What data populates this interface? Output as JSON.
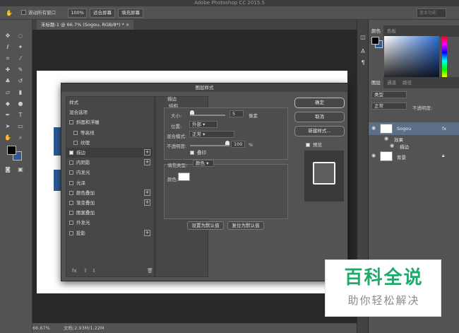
{
  "app": {
    "title": "Adobe Photoshop CC 2015.5"
  },
  "options_bar": {
    "scroll_all_label": "滚动所有窗口",
    "zoom_btn": "100%",
    "fit_screen_btn": "适合屏幕",
    "fill_screen_btn": "填充屏幕",
    "workspace": "基本功能"
  },
  "document": {
    "tab_label": "未标题-1 @ 66.7% (Sogou, RGB/8*) *",
    "zoom": "66.67%",
    "doc_info": "文档:2.93M/1.22M"
  },
  "colors": {
    "foreground": "#050505",
    "background": "#2a5d96"
  },
  "right_panel": {
    "color_tab": "颜色",
    "swatches_tab": "色板",
    "layers_tab": "图层",
    "channels_tab": "通道",
    "paths_tab": "路径",
    "kind_filter": "类型",
    "blend_mode": "正常",
    "opacity_label": "不透明度:",
    "layers": [
      {
        "name": "Sogou",
        "fx": "fx"
      },
      {
        "name": "效果"
      },
      {
        "name": "描边"
      },
      {
        "name": "背景"
      }
    ]
  },
  "dialog": {
    "title": "图层样式",
    "styles": [
      {
        "label": "样式",
        "checkbox": false,
        "plus": false,
        "checked": false,
        "indent": 0
      },
      {
        "label": "混合选项",
        "checkbox": false,
        "plus": false,
        "checked": false,
        "indent": 0
      },
      {
        "label": "斜面和浮雕",
        "checkbox": true,
        "plus": false,
        "checked": false,
        "indent": 0
      },
      {
        "label": "等高线",
        "checkbox": true,
        "plus": false,
        "checked": false,
        "indent": 1
      },
      {
        "label": "纹理",
        "checkbox": true,
        "plus": false,
        "checked": false,
        "indent": 1
      },
      {
        "label": "描边",
        "checkbox": true,
        "plus": true,
        "checked": true,
        "indent": 0
      },
      {
        "label": "内阴影",
        "checkbox": true,
        "plus": true,
        "checked": false,
        "indent": 0
      },
      {
        "label": "内发光",
        "checkbox": true,
        "plus": false,
        "checked": false,
        "indent": 0
      },
      {
        "label": "光泽",
        "checkbox": true,
        "plus": false,
        "checked": false,
        "indent": 0
      },
      {
        "label": "颜色叠加",
        "checkbox": true,
        "plus": true,
        "checked": false,
        "indent": 0
      },
      {
        "label": "渐变叠加",
        "checkbox": true,
        "plus": true,
        "checked": false,
        "indent": 0
      },
      {
        "label": "图案叠加",
        "checkbox": true,
        "plus": false,
        "checked": false,
        "indent": 0
      },
      {
        "label": "外发光",
        "checkbox": true,
        "plus": false,
        "checked": false,
        "indent": 0
      },
      {
        "label": "投影",
        "checkbox": true,
        "plus": true,
        "checked": false,
        "indent": 0
      }
    ],
    "list_footer": "fx",
    "stroke": {
      "section_title": "描边",
      "structure_title": "结构",
      "size_label": "大小:",
      "size_value": "5",
      "size_unit": "像素",
      "position_label": "位置:",
      "position_value": "外部",
      "blend_label": "混合模式:",
      "blend_value": "正常",
      "opacity_label": "不透明度:",
      "opacity_value": "100",
      "opacity_unit": "%",
      "overprint_label": "叠印",
      "fill_type_label": "填充类型:",
      "fill_type_value": "颜色",
      "color_label": "颜色:",
      "stroke_color": "#ffffff"
    },
    "set_default_btn": "设置为默认值",
    "reset_default_btn": "复位为默认值",
    "ok_btn": "确定",
    "cancel_btn": "取消",
    "new_style_btn": "新建样式...",
    "preview_label": "预览"
  },
  "watermark": {
    "main": "百科全说",
    "sub": "助你轻松解决"
  }
}
